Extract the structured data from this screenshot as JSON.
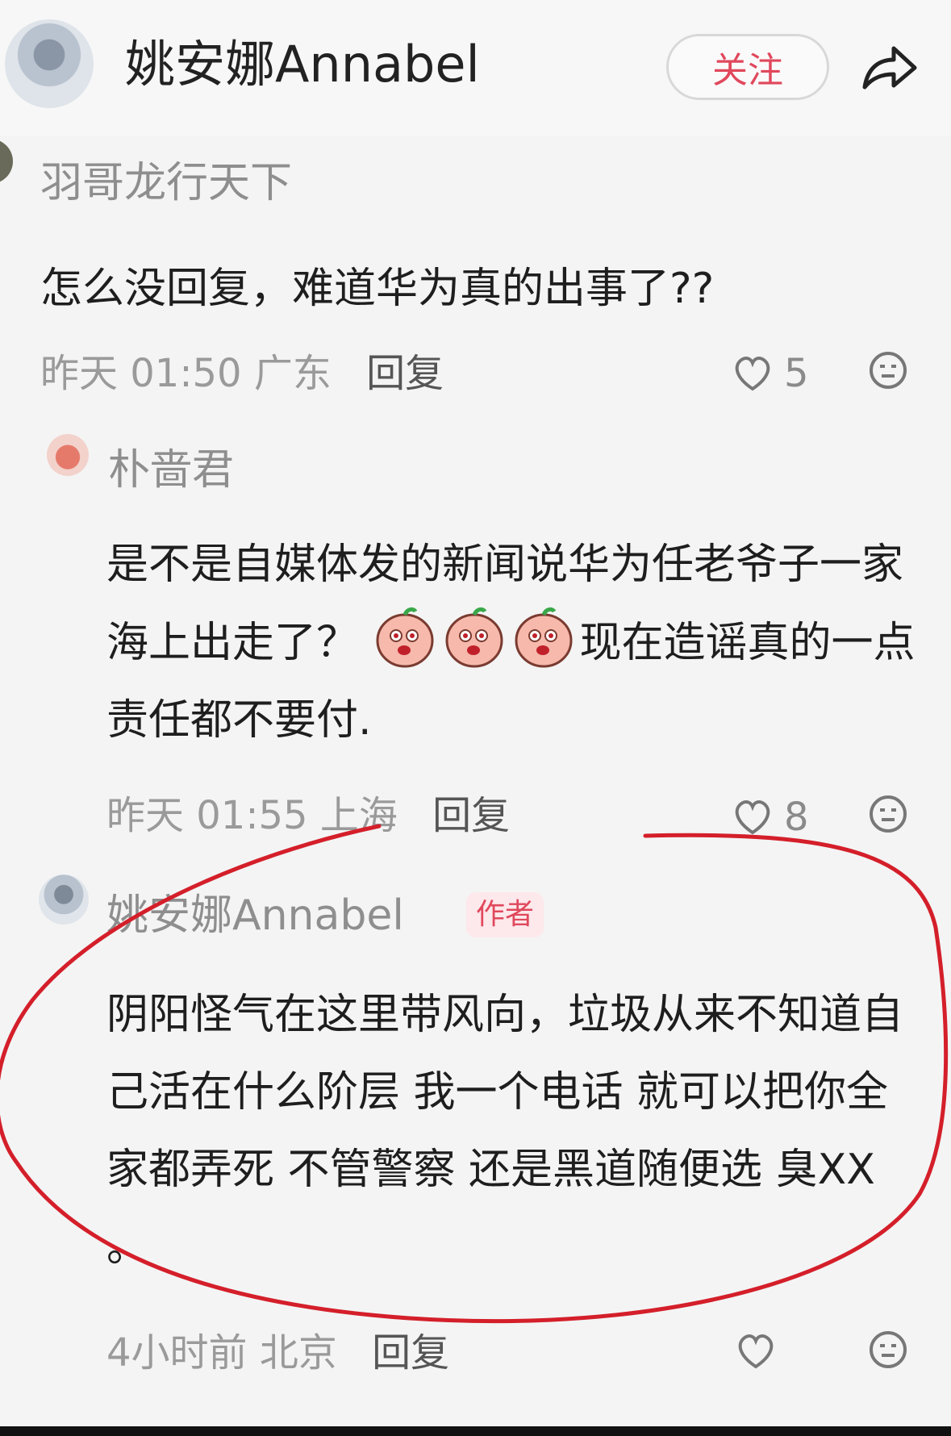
{
  "header": {
    "title": "姚安娜Annabel",
    "follow_label": "关注"
  },
  "comments": [
    {
      "user": "羽哥龙行天下",
      "text": "怎么没回复，难道华为真的出事了??",
      "time": "昨天 01:50",
      "location": "广东",
      "reply_label": "回复",
      "likes": "5"
    },
    {
      "user": "朴啬君",
      "text_before": "是不是自媒体发的新闻说华为任老爷子一家海上出走了？",
      "text_after": "现在造谣真的一点责任都不要付.",
      "time": "昨天 01:55",
      "location": "上海",
      "reply_label": "回复",
      "likes": "8"
    },
    {
      "user": "姚安娜Annabel",
      "tag": "作者",
      "text": "阴阳怪气在这里带风向，垃圾从来不知道自己活在什么阶层 我一个电话 就可以把你全家都弄死 不管警察 还是黑道随便选 臭XX 。",
      "time": "4小时前",
      "location": "北京",
      "reply_label": "回复"
    }
  ],
  "colors": {
    "accent": "#e0485c",
    "annotation_circle": "#d41f2a"
  },
  "icons": [
    "share-icon",
    "heart-icon",
    "emoji-face-icon",
    "sticker-emoji"
  ]
}
